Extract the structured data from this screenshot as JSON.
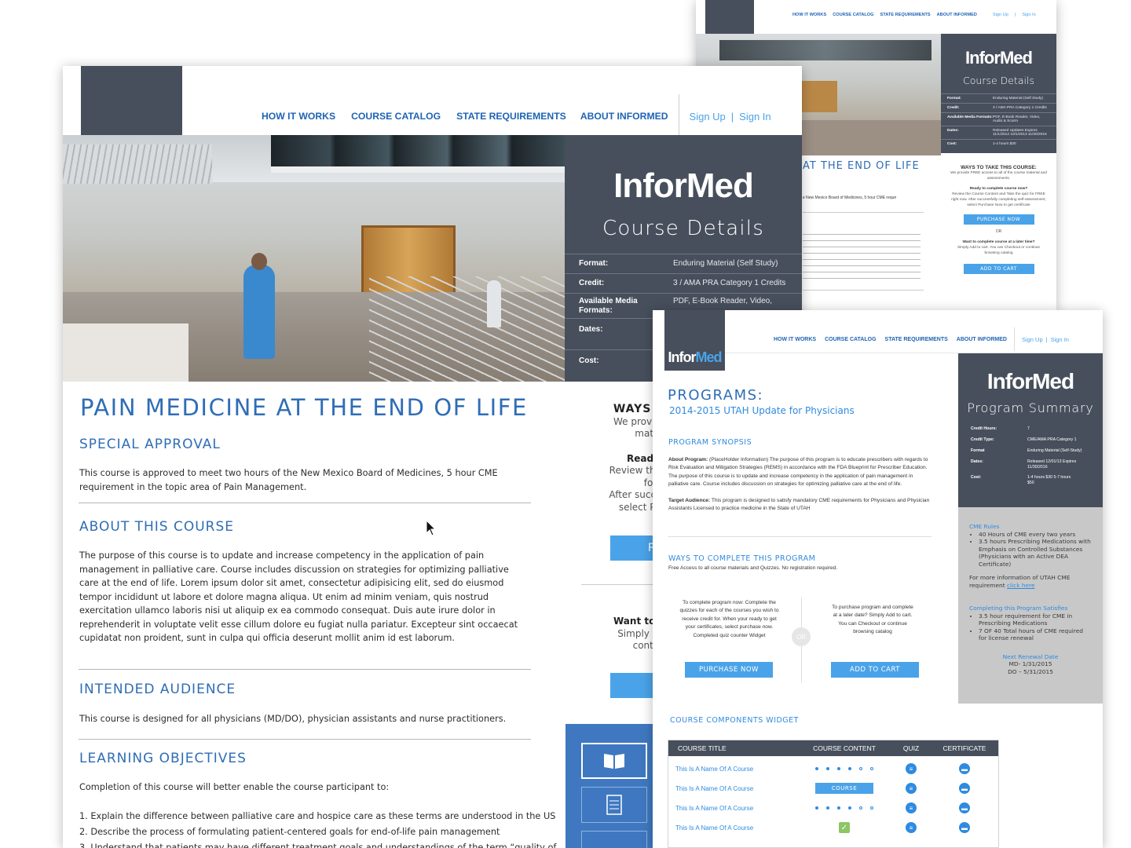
{
  "brand": {
    "logo_part1": "Infor",
    "logo_part2": "Med"
  },
  "nav": {
    "how_it_works": "HOW IT WORKS",
    "course_catalog": "COURSE CATALOG",
    "state_requirements": "STATE REQUIREMENTS",
    "about_informed": "ABOUT INFORMED",
    "sign_up": "Sign Up",
    "separator": "|",
    "sign_in": "Sign In"
  },
  "course_page": {
    "title": "PAIN MEDICINE AT THE END OF LIFE",
    "panel_title": "Course Details",
    "details": [
      {
        "key": "Format:",
        "value": "Enduring Material (Self Study)"
      },
      {
        "key": "Credit:",
        "value": "3 / AMA PRA Category 1 Credits"
      },
      {
        "key": "Available Media Formats:",
        "value": "PDF, E-Book Reader, Video,"
      },
      {
        "key": "Dates:",
        "value": ""
      },
      {
        "key": "Cost:",
        "value": ""
      }
    ],
    "special_approval_heading": "SPECIAL APPROVAL",
    "special_approval_text": "This course is approved to meet two hours of the New Mexico Board of Medicines, 5 hour CME requirement in the topic area of Pain Management.",
    "about_heading": "ABOUT THIS COURSE",
    "about_text": "The purpose of this course is to update and increase competency in the application of pain management in palliative care. Course includes discussion on strategies for optimizing palliative care at the end of life. Lorem ipsum dolor sit amet, consectetur adipisicing elit, sed do eiusmod tempor incididunt ut labore et dolore magna aliqua. Ut enim ad minim veniam, quis nostrud exercitation ullamco laboris nisi ut aliquip ex ea commodo consequat. Duis aute irure dolor in reprehenderit in voluptate velit esse cillum dolore eu fugiat nulla pariatur. Excepteur sint occaecat cupidatat non proident, sunt in culpa qui officia deserunt mollit anim id est laborum.",
    "audience_heading": "INTENDED AUDIENCE",
    "audience_text": "This course is designed for all physicians (MD/DO), physician assistants and nurse practitioners.",
    "objectives_heading": "LEARNING OBJECTIVES",
    "objectives_intro": "Completion of this course will better enable the course participant to:",
    "objectives": [
      "1. Explain the difference between palliative care and hospice care as these terms are understood in the US",
      "2. Describe the process of formulating patient-centered goals for end-of-life pain management",
      "3. Understand that patients may have different treatment goals and understandings of the term “quality of"
    ],
    "ways_heading": "WAYS TO T",
    "ways_line1": "We provide FRE",
    "ways_line2": "materi",
    "ready_heading": "Ready to",
    "ready_line1": "Review the Cours",
    "ready_line2": "for",
    "ready_line3": "After successfully",
    "ready_line4": "select Purcha",
    "purchase_btn": "PUI",
    "later_heading": "Want to  comp",
    "later_line1": "Simply Add to",
    "later_line2": "continu",
    "cart_btn": "A"
  },
  "course_page_back": {
    "panel_title": "Course Details",
    "details": [
      {
        "key": "Format:",
        "value": "Enduring Material (Self Study)"
      },
      {
        "key": "Credit:",
        "value": "3 / AMA PRA Category 1 Credits"
      },
      {
        "key": "Available Media Formats:",
        "value": "PDF, E-Book Reader, Video, Audio & Scorm"
      },
      {
        "key": "Dates:",
        "value": "Released  Updates  Expires 11/1/2012  10/1/2013  11/30/2016"
      },
      {
        "key": "Cost:",
        "value": "1-4 hours $30"
      }
    ],
    "title_fragment": "AT THE END OF LIFE",
    "text_fragment": "e New Mexico Board of Medicines, 5 hour CME requir",
    "ways_heading": "WAYS TO TAKE THIS COURSE:",
    "ways_text": "We provide FREE access to all of the course material and assessments.",
    "ready_heading": "Ready to complete course now?",
    "ready_text": "Review the Course Content and Take the quiz for FREE right now. After successfully completing self-assessment, select Purchase Now to get certificate",
    "purchase_btn": "PURCHASE NOW",
    "or_label": "OR",
    "later_heading": "Want to  complete course at a later time?",
    "later_text": "Simply Add to cart. You can Checkout or continue browsing catalog",
    "cart_btn": "ADD TO CART"
  },
  "program_page": {
    "heading": "PROGRAMS:",
    "subheading": "2014-2015 UTAH Update for Physicians",
    "panel_title": "Program Summary",
    "summary": [
      {
        "key": "Credit Hours:",
        "value": "7"
      },
      {
        "key": "Credit Type:",
        "value": "CME/AMA PRA Category 1"
      },
      {
        "key": "Format",
        "value": "Enduring Material (Self-Study)"
      },
      {
        "key": "Dates:",
        "value": "Released 12/01/13   Expires 11/30/2016"
      },
      {
        "key": "Cost:",
        "value": "1-4 hours $30  5-7 hours $50"
      }
    ],
    "cme_rules_heading": "CME Rules",
    "cme_rules": [
      "40 Hours of CME every two years",
      "3.5 hours Prescribing Medications with Emphasis on Controlled Substances (Physicians with an Active DEA Certificate)"
    ],
    "more_info": "For more information of UTAH CME requirement",
    "click_here": "click here",
    "satisfies_heading": "Completing this Program Satisfies",
    "satisfies": [
      "3.5 hour requirement for CME in Prescribing Medications",
      "7 OF 40 Total hours of CME required for license renewal"
    ],
    "renewal_heading": "Next Renewal Date",
    "renewal_md": "MD- 1/31/2015",
    "renewal_do": "DO – 5/31/2015",
    "synopsis_heading": "PROGRAM SYNOPSIS",
    "about_label": "About Program:",
    "about_text": " (PlaceHolder Information) The purpose of this program is to educate prescribers with regards to Risk Evaluation and Mitigation Strategies (REMS) in accordance with the FDA Blueprint for Prescriber Education. The purpose of this course is to update and increase competency in the application of pain management in palliative care. Course includes discussion on strategies for optimizing palliative care at the end of life.",
    "audience_label": "Target Audience:",
    "audience_text": " This program is designed to satisfy mandatory CME requirements for Physicians and Physician Assistants Licensed to practice medicine in the State of UTAH",
    "ways_heading": "WAYS TO COMPLETE THIS PROGRAM",
    "ways_text": "Free Access to all course materials and Quizzes. No registration required.",
    "now_text": "To complete program now: Complete the quizzes for each of the courses you wish to receive credit for. When your ready to get your certificates, select purchase now. Completed quiz counter Widget",
    "or_label": "OR",
    "later_text": "To purchase program and complete at a later date? Simply Add to cart. You can Checkout or continue browsing catalog",
    "purchase_btn": "PURCHASE NOW",
    "cart_btn": "ADD TO CART",
    "widget_heading": "COURSE COMPONENTS WIDGET",
    "table_headers": [
      "COURSE TITLE",
      "COURSE CONTENT",
      "QUIZ",
      "CERTIFICATE"
    ],
    "rows": [
      {
        "title": "This Is A Name Of A Course",
        "content": "dots",
        "filled": 4
      },
      {
        "title": "This Is A Name Of A Course",
        "content": "COURSE",
        "filled": 0
      },
      {
        "title": "This Is A Name Of A Course",
        "content": "dots",
        "filled": 4
      },
      {
        "title": "This Is A Name Of A Course",
        "content": "check",
        "filled": 0
      }
    ]
  },
  "colors": {
    "brand_dark": "#474f5c",
    "brand_blue": "#2f6db6",
    "accent_blue": "#4aa3e8"
  },
  "icons": [
    "book-icon",
    "document-icon",
    "chart-icon",
    "quiz-icon",
    "certificate-icon",
    "check-icon",
    "cursor-icon"
  ]
}
